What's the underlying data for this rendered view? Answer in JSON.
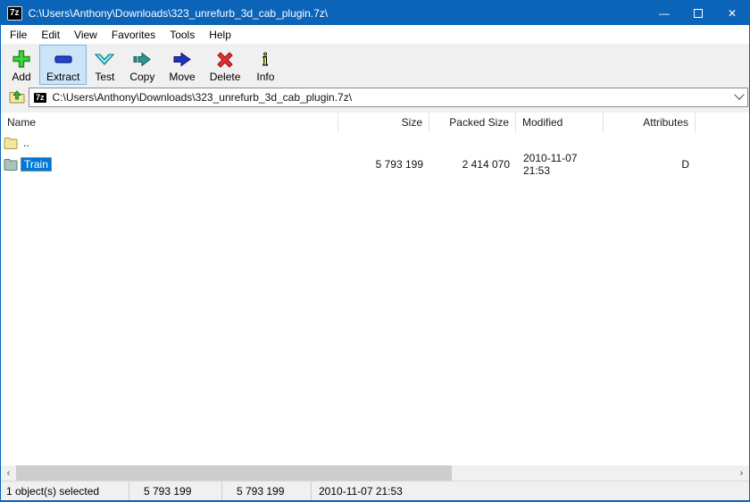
{
  "window": {
    "app_badge": "7z",
    "title": "C:\\Users\\Anthony\\Downloads\\323_unrefurb_3d_cab_plugin.7z\\",
    "controls": {
      "minimize": "—",
      "close": "✕"
    }
  },
  "menu": {
    "items": [
      "File",
      "Edit",
      "View",
      "Favorites",
      "Tools",
      "Help"
    ]
  },
  "toolbar": {
    "buttons": [
      {
        "label": "Add",
        "icon": "add-plus-icon"
      },
      {
        "label": "Extract",
        "icon": "extract-bar-icon",
        "highlighted": true
      },
      {
        "label": "Test",
        "icon": "test-check-icon"
      },
      {
        "label": "Copy",
        "icon": "copy-arrow-icon"
      },
      {
        "label": "Move",
        "icon": "move-arrow-icon"
      },
      {
        "label": "Delete",
        "icon": "delete-x-icon"
      },
      {
        "label": "Info",
        "icon": "info-icon"
      }
    ]
  },
  "address_bar": {
    "archive_badge": "7z",
    "path": "C:\\Users\\Anthony\\Downloads\\323_unrefurb_3d_cab_plugin.7z\\"
  },
  "list": {
    "columns": [
      "Name",
      "Size",
      "Packed Size",
      "Modified",
      "Attributes"
    ],
    "rows": [
      {
        "name": "..",
        "size": "",
        "packed_size": "",
        "modified": "",
        "attributes": "",
        "icon": "parent-folder",
        "selected": false
      },
      {
        "name": "Train",
        "size": "5 793 199",
        "packed_size": "2 414 070",
        "modified": "2010-11-07 21:53",
        "attributes": "D",
        "icon": "archive-folder",
        "selected": true
      }
    ]
  },
  "scrollbar": {
    "left_arrow": "‹",
    "right_arrow": "›"
  },
  "status_bar": {
    "cells": [
      "1 object(s) selected",
      "5 793 199",
      "5 793 199",
      "2010-11-07 21:53"
    ]
  },
  "colors": {
    "titlebar": "#0c64b8",
    "selection": "#0078d7",
    "toolbar_highlight": "#cce4f7"
  }
}
